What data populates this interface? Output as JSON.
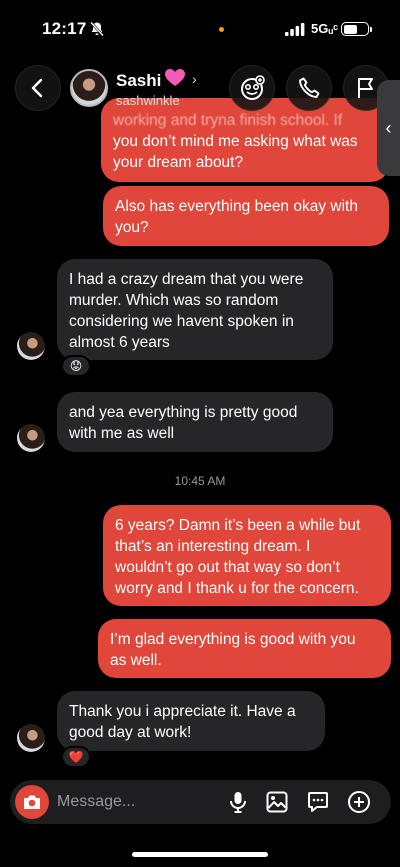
{
  "status_bar": {
    "time": "12:17",
    "network": "5Gᵤᶜ",
    "battery_level": 0.6
  },
  "header": {
    "name": "Sashi",
    "name_emoji": "heart",
    "chevron": "›",
    "username": "sashwinkle",
    "icons": [
      "back-chevron-icon",
      "effects-icon",
      "phone-icon",
      "flag-icon"
    ]
  },
  "messages": [
    {
      "dir": "out",
      "lines": [
        "working and tryna finish school. If",
        "you don’t mind me asking what was",
        "your dream about?"
      ]
    },
    {
      "dir": "out",
      "lines": [
        "Also has everything been okay with",
        "you?"
      ]
    },
    {
      "dir": "in",
      "lines": [
        "I had a crazy dream that you were",
        "murder. Which was so random",
        "considering we havent spoken in",
        "almost 6 years"
      ],
      "reaction": "😟"
    },
    {
      "dir": "in",
      "lines": [
        "and yea everything is pretty good",
        "with me as well"
      ]
    },
    {
      "dir": "out",
      "lines": [
        "6 years? Damn it’s been a while but",
        "that’s an interesting dream. I",
        "wouldn’t go out that way so don’t",
        "worry and I thank u for the concern."
      ]
    },
    {
      "dir": "out",
      "lines": [
        "I’m glad everything is good with you",
        "as well."
      ]
    },
    {
      "dir": "in",
      "lines": [
        "Thank you i appreciate it. Have a",
        "good day at work!"
      ],
      "reaction": "❤️"
    }
  ],
  "timestamp": "10:45 AM",
  "composer": {
    "placeholder": "Message...",
    "icons": [
      "camera-icon",
      "microphone-icon",
      "gallery-icon",
      "sticker-icon",
      "plus-icon"
    ]
  },
  "side_tab": "‹",
  "colors": {
    "outgoing": "#e0463a",
    "incoming": "#262628",
    "background": "#000000"
  }
}
